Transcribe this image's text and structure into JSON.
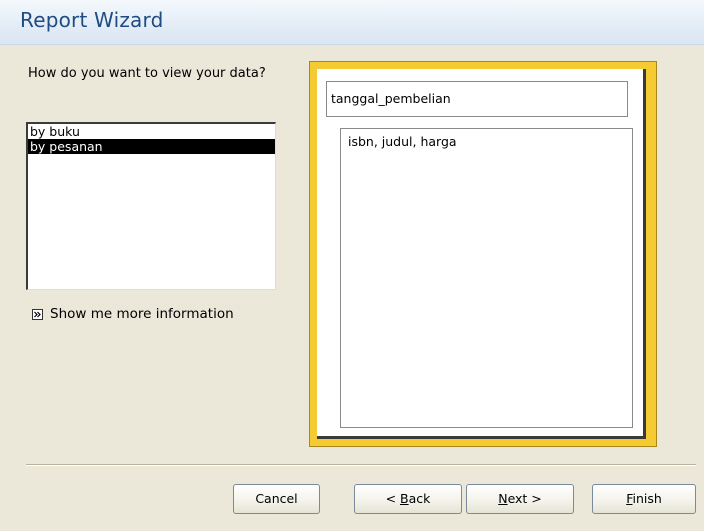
{
  "window": {
    "title": "Report Wizard"
  },
  "left_panel": {
    "question": "How do you want to view your data?",
    "view_options": [
      {
        "label": "by buku",
        "selected": false
      },
      {
        "label": "by pesanan",
        "selected": true
      }
    ],
    "show_more_label": "Show me more information"
  },
  "preview": {
    "group_field": "tanggal_pembelian",
    "detail_fields": "isbn, judul, harga"
  },
  "buttons": {
    "cancel": "Cancel",
    "back_prefix": "< ",
    "back_accel": "B",
    "back_rest": "ack",
    "next_accel": "N",
    "next_rest": "ext >",
    "finish_accel": "F",
    "finish_rest": "inish"
  },
  "colors": {
    "title_text": "#1f4b82",
    "preview_frame": "#f5cb34",
    "dialog_bg": "#ebe8da",
    "selection_bg": "#000000"
  }
}
